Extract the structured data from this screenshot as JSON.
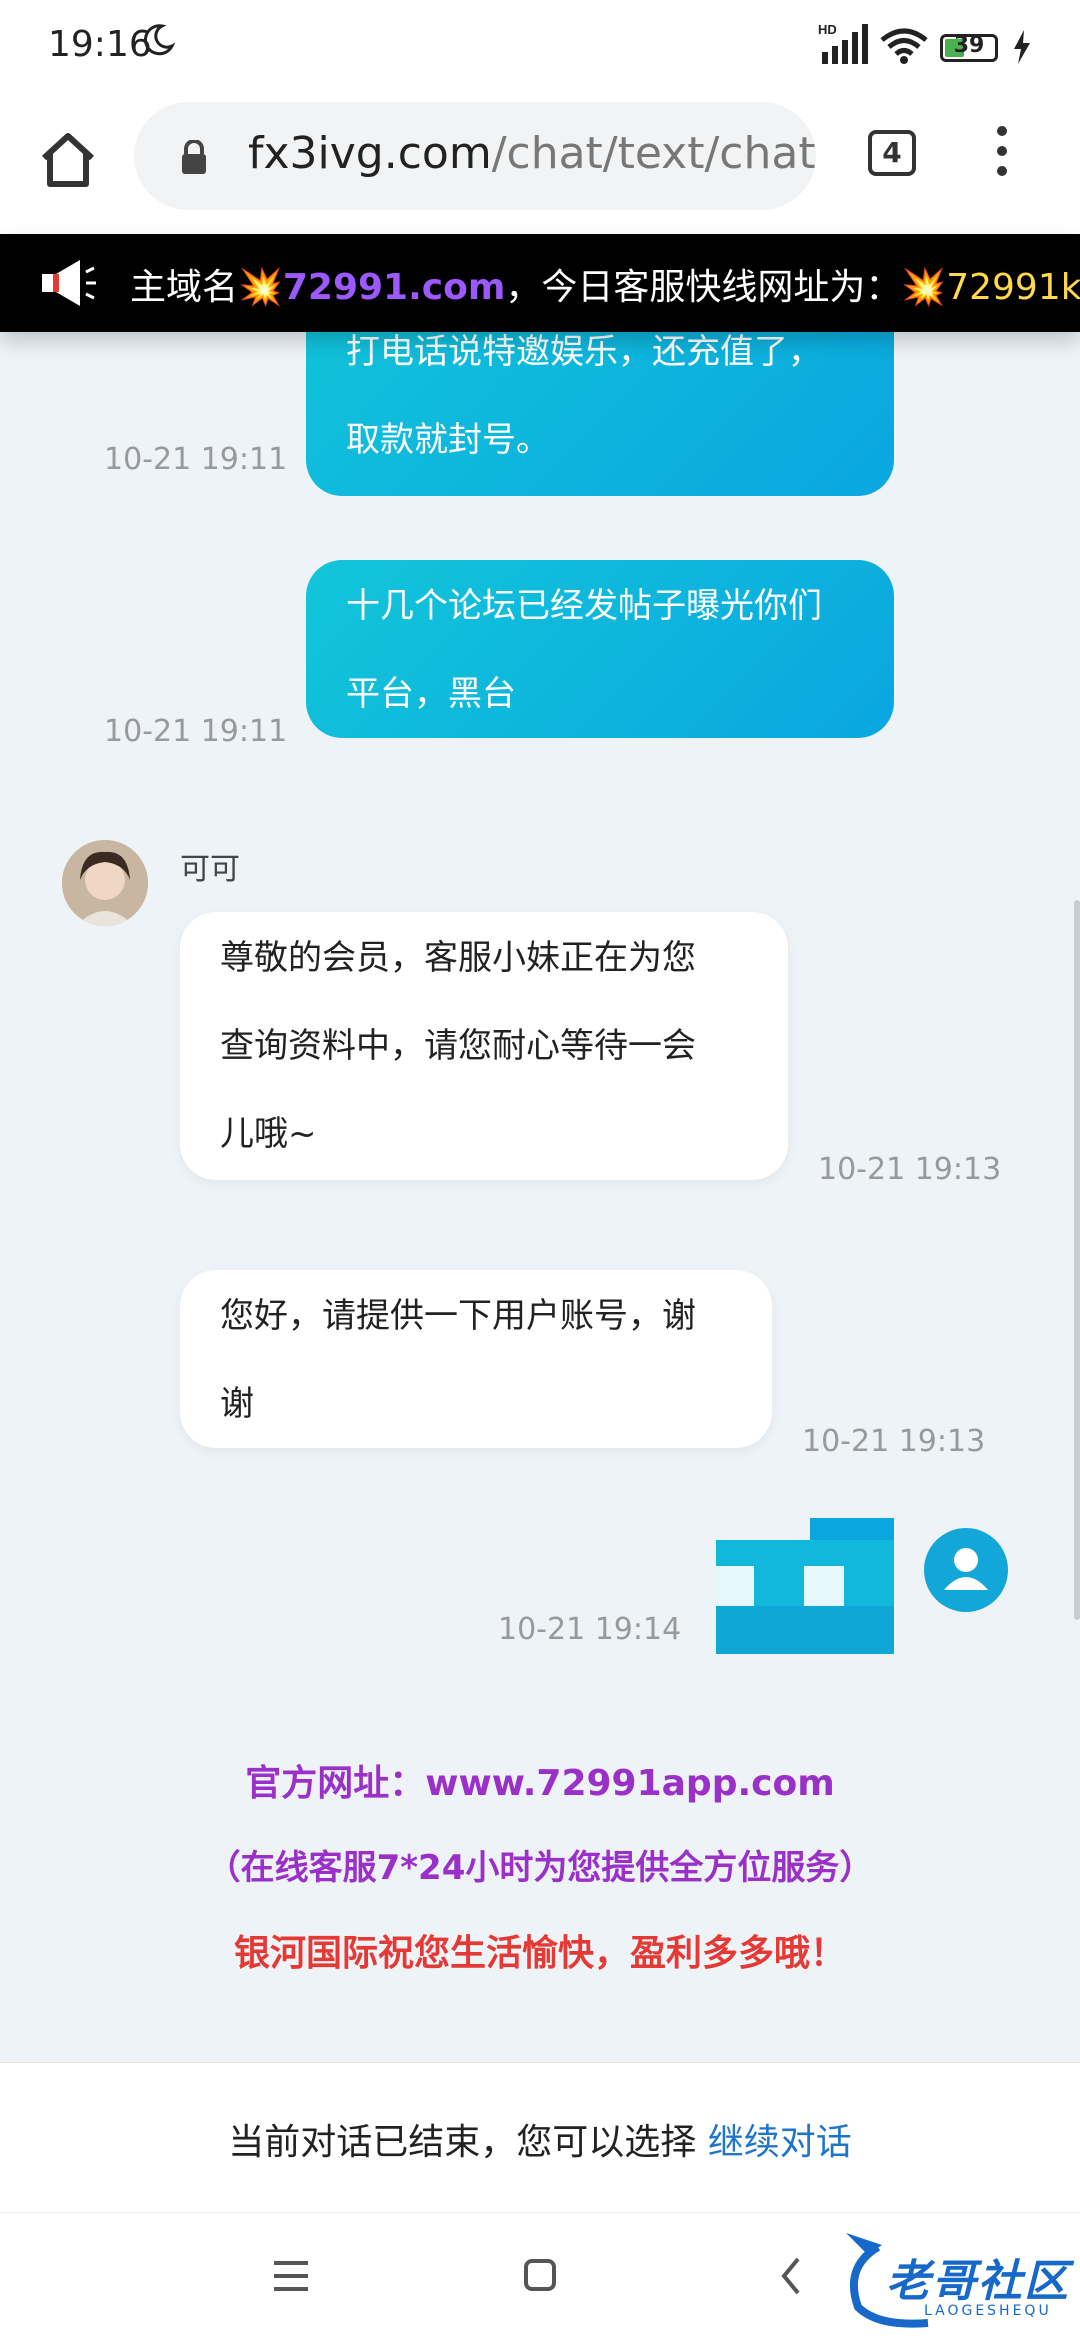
{
  "status_bar": {
    "time": "19:16",
    "signal_badge": "HD",
    "battery": "39",
    "battery_level": 0.39
  },
  "browser": {
    "url_host": "fx3ivg.com",
    "url_path": "/chat/text/chat",
    "tab_count": "4"
  },
  "marquee": {
    "prefix": "主域名",
    "domain": "72991.com",
    "middle": "，今日客服快线网址为：",
    "link": "72991k"
  },
  "messages": [
    {
      "side": "out",
      "lines": [
        "打电话说特邀娱乐，还充值了，",
        "取款就封号。"
      ],
      "time": "10-21 19:11"
    },
    {
      "side": "out",
      "lines": [
        "十几个论坛已经发帖子曝光你们",
        "平台，黑台"
      ],
      "time": "10-21 19:11"
    },
    {
      "side": "in",
      "sender": "可可",
      "lines": [
        "尊敬的会员，客服小妹正在为您",
        "查询资料中，请您耐心等待一会",
        "儿哦~"
      ],
      "time": "10-21 19:13"
    },
    {
      "side": "in",
      "lines": [
        "您好，请提供一下用户账号，谢",
        "谢"
      ],
      "time": "10-21 19:13"
    },
    {
      "side": "out",
      "type": "image",
      "time": "10-21 19:14"
    }
  ],
  "promo": {
    "website": "官方网址：www.72991app.com",
    "service": "（在线客服7*24小时为您提供全方位服务）",
    "wish": "银河国际祝您生活愉快，盈利多多哦！"
  },
  "footer": {
    "ended_text": "当前对话已结束，您可以选择",
    "continue_link": "继续对话"
  },
  "watermark": {
    "text": "老哥社区",
    "sub": "LAOGESHEQU"
  },
  "colors": {
    "bubble_out": "#12c6d9",
    "promo_purple": "#9b30c9",
    "promo_red": "#e53935",
    "link_blue": "#1f76c9",
    "marquee_bg": "#000000"
  },
  "icons": [
    "moon-icon",
    "signal-icon",
    "wifi-icon",
    "battery-icon",
    "charging-icon",
    "home-icon",
    "lock-icon",
    "tabs-icon",
    "more-vert-icon",
    "megaphone-icon",
    "user-avatar-icon",
    "nav-menu-icon",
    "nav-home-icon",
    "nav-back-icon"
  ]
}
